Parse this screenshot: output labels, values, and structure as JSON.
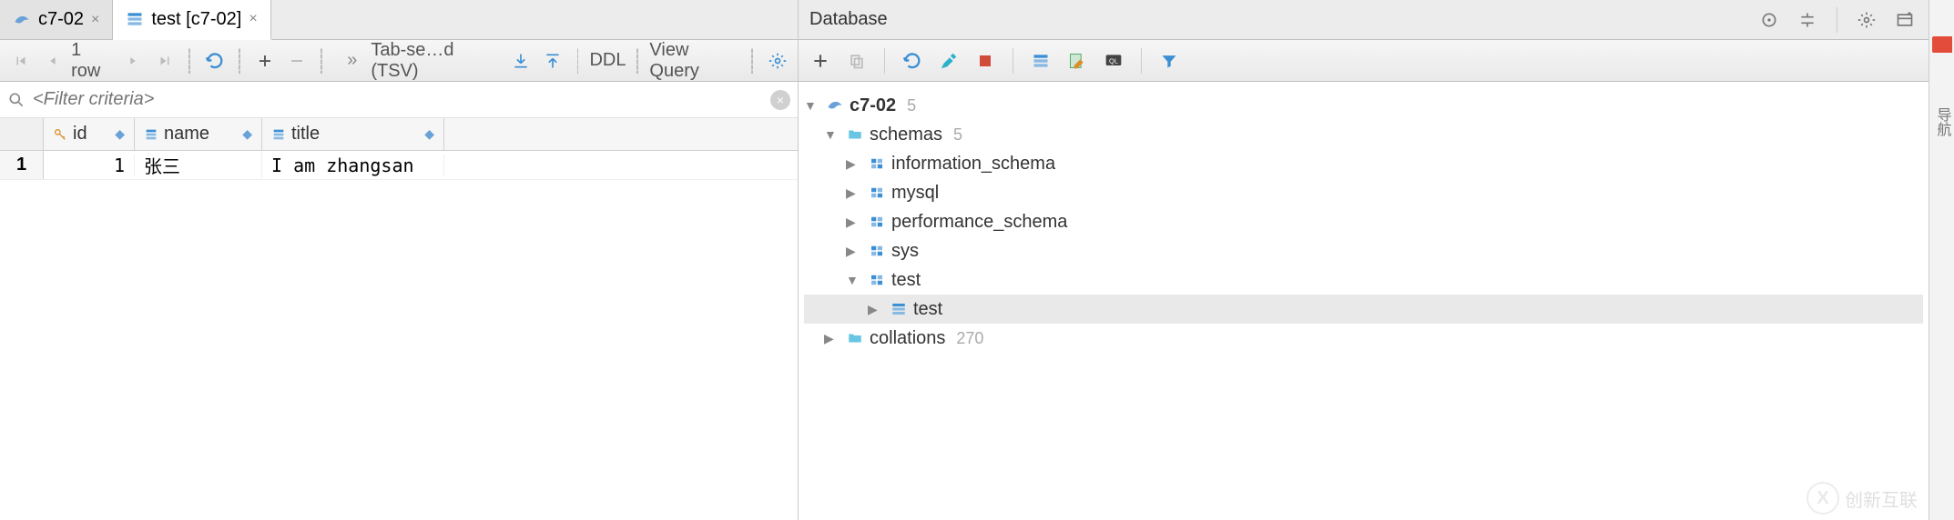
{
  "tabs": [
    {
      "label": "c7-02",
      "icon": "dolphin-icon",
      "active": false
    },
    {
      "label": "test [c7-02]",
      "icon": "table-icon",
      "active": true
    }
  ],
  "toolbar": {
    "row_count": "1 row",
    "export_label": "Tab-se…d (TSV)",
    "ddl_label": "DDL",
    "view_query_label": "View Query"
  },
  "filter": {
    "placeholder": "<Filter criteria>"
  },
  "table": {
    "columns": [
      {
        "name": "id",
        "icon": "key-icon"
      },
      {
        "name": "name",
        "icon": "column-icon"
      },
      {
        "name": "title",
        "icon": "column-icon"
      }
    ],
    "rows": [
      {
        "n": "1",
        "id": "1",
        "name": "张三",
        "title": "I am zhangsan"
      }
    ]
  },
  "database_panel": {
    "title": "Database"
  },
  "tree": {
    "datasource": {
      "label": "c7-02",
      "count": "5"
    },
    "schemas_label": "schemas",
    "schemas_count": "5",
    "schemas": [
      {
        "label": "information_schema"
      },
      {
        "label": "mysql"
      },
      {
        "label": "performance_schema"
      },
      {
        "label": "sys"
      },
      {
        "label": "test",
        "expanded": true,
        "children": [
          {
            "label": "test",
            "selected": true
          }
        ]
      }
    ],
    "collations_label": "collations",
    "collations_count": "270"
  },
  "far_right": {
    "vlabel": "导航"
  },
  "watermark": {
    "text": "创新互联",
    "badge": "X"
  }
}
